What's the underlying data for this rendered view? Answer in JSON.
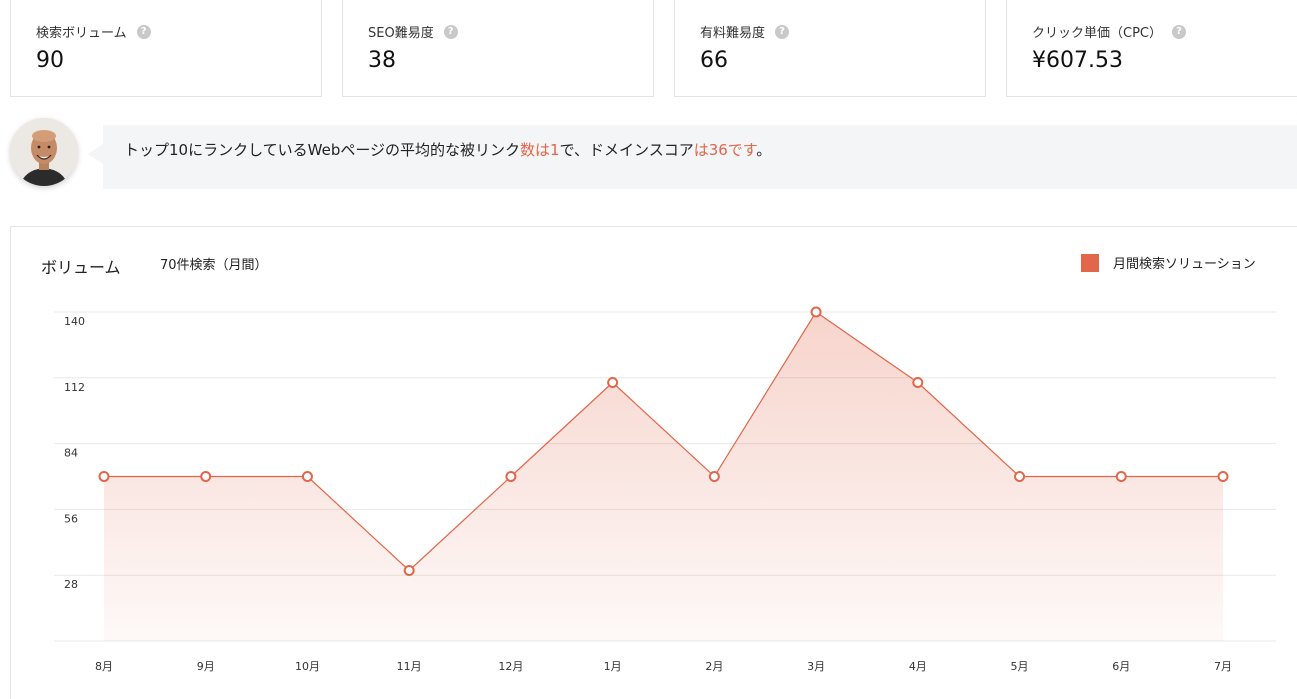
{
  "metrics": [
    {
      "label": "検索ボリューム",
      "value": "90"
    },
    {
      "label": "SEO難易度",
      "value": "38"
    },
    {
      "label": "有料難易度",
      "value": "66"
    },
    {
      "label": "クリック単価（CPC）",
      "value": "¥607.53"
    }
  ],
  "help_icon_glyph": "?",
  "insight": {
    "prefix": "トップ10にランクしているWebページの平均的な被リンク",
    "hl1": "数は1",
    "middle": "で、ドメインスコア",
    "hl2": "は36です",
    "suffix": "。"
  },
  "chart": {
    "title": "ボリューム",
    "subtitle": "70件検索（月間）",
    "legend_label": "月間検索ソリューション"
  },
  "colors": {
    "accent": "#e2664a",
    "grid": "#e8e8e8"
  },
  "chart_data": {
    "type": "area",
    "categories": [
      "8月",
      "9月",
      "10月",
      "11月",
      "12月",
      "1月",
      "2月",
      "3月",
      "4月",
      "5月",
      "6月",
      "7月"
    ],
    "series": [
      {
        "name": "月間検索ソリューション",
        "values": [
          70,
          70,
          70,
          30,
          70,
          110,
          70,
          140,
          110,
          70,
          70,
          70
        ]
      }
    ],
    "yticks": [
      28,
      56,
      84,
      112,
      140
    ],
    "ylim": [
      0,
      140
    ],
    "grid": true,
    "legend_position": "top-right"
  }
}
